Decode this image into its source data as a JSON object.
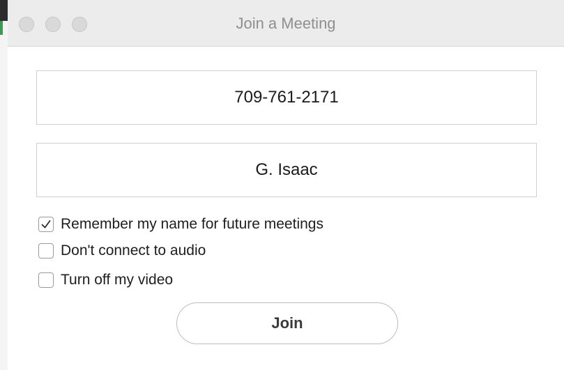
{
  "window": {
    "title": "Join a Meeting"
  },
  "form": {
    "meeting_id": {
      "value": "709-761-2171"
    },
    "name": {
      "value": "G. Isaac"
    },
    "options": [
      {
        "label": "Remember my name for future meetings",
        "checked": true
      },
      {
        "label": "Don't connect to audio",
        "checked": false
      },
      {
        "label": "Turn off my video",
        "checked": false
      }
    ],
    "join_label": "Join"
  },
  "icons": {
    "checkmark": "checkmark-icon",
    "traffic_lights": [
      "close-window-icon",
      "minimize-window-icon",
      "zoom-window-icon"
    ]
  },
  "colors": {
    "titlebar": "#ececec",
    "traffic_light_inactive": "#d9d9d9",
    "field_border": "#cfcfcf",
    "text": "#1e1e1e"
  }
}
